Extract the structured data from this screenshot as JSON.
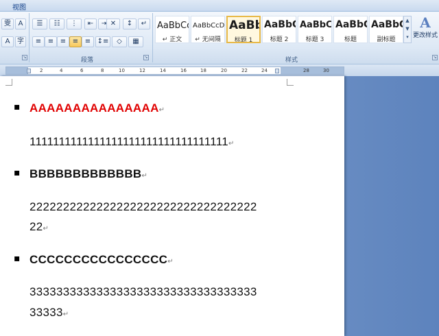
{
  "tabs": {
    "view": "视图"
  },
  "paragraph_group": {
    "label": "段落",
    "buttons": {
      "bullets": "☰",
      "numbering": "☷",
      "multilevel": "⋮",
      "decrease_indent": "⇤",
      "increase_indent": "⇥",
      "chinese_layout": "✕",
      "sort": "↕",
      "show_marks": "↵",
      "align_left": "≡",
      "center": "≡",
      "align_right": "≡",
      "justify": "≡",
      "distributed": "≡",
      "line_spacing": "↕≡",
      "shading": "◇",
      "borders": "▦"
    }
  },
  "font_group": {
    "buttons": {
      "phonetic": "雯",
      "char_border": "A",
      "char_shading": "A",
      "enclose": "字"
    }
  },
  "styles_group": {
    "label": "样式",
    "items": [
      {
        "sample": "AaBbCc",
        "name": "正文",
        "mark": "↵"
      },
      {
        "sample": "AaBbCcDd",
        "name": "无间隔",
        "mark": "↵"
      },
      {
        "sample": "AaBb",
        "name": "标题 1",
        "active": true
      },
      {
        "sample": "AaBbC",
        "name": "标题 2"
      },
      {
        "sample": "AaBbC",
        "name": "标题 3"
      },
      {
        "sample": "AaBbC",
        "name": "标题"
      },
      {
        "sample": "AaBbC",
        "name": "副标题"
      }
    ],
    "change_styles": {
      "icon_text": "A",
      "label": "更改样式"
    }
  },
  "ruler": {
    "numbers": [
      "2",
      "4",
      "6",
      "8",
      "10",
      "12",
      "14",
      "16",
      "18",
      "20",
      "22",
      "24",
      "28",
      "30"
    ]
  },
  "document": {
    "paragraph_mark": "↵",
    "bullet_symbol": "▪",
    "items": [
      {
        "text": "AAAAAAAAAAAAAAA"
      },
      {
        "text": "1111111111111111111111111111111111"
      },
      {
        "text": "BBBBBBBBBBBBB"
      },
      {
        "line1": "2222222222222222222222222222222222",
        "line2": "22"
      },
      {
        "text": "CCCCCCCCCCCCCCCC"
      },
      {
        "line1": "3333333333333333333333333333333333",
        "line2": "33333"
      }
    ]
  },
  "colors": {
    "red_text": "#e00000",
    "ribbon": "#dde8f5",
    "workspace": "#6f92c6"
  }
}
